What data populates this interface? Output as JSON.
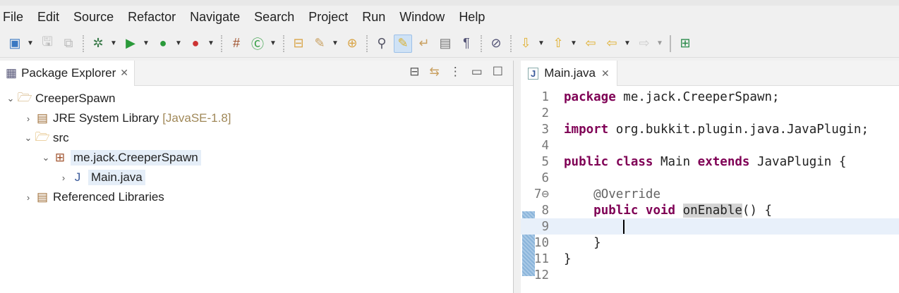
{
  "menu": [
    "File",
    "Edit",
    "Source",
    "Refactor",
    "Navigate",
    "Search",
    "Project",
    "Run",
    "Window",
    "Help"
  ],
  "explorer": {
    "title": "Package Explorer",
    "tree": [
      {
        "label": "CreeperSpawn",
        "icon": "project-icon",
        "depth": 0,
        "expanded": true
      },
      {
        "label": "JRE System Library",
        "suffix": "[JavaSE-1.8]",
        "icon": "library-icon",
        "depth": 1,
        "expanded": false
      },
      {
        "label": "src",
        "icon": "source-folder-icon",
        "depth": 1,
        "expanded": true
      },
      {
        "label": "me.jack.CreeperSpawn",
        "icon": "package-icon",
        "depth": 2,
        "expanded": true
      },
      {
        "label": "Main.java",
        "icon": "java-file-icon",
        "depth": 3,
        "expanded": false,
        "selected": true
      },
      {
        "label": "Referenced Libraries",
        "icon": "library-icon",
        "depth": 1,
        "expanded": false
      }
    ]
  },
  "editor": {
    "tab": "Main.java",
    "lines": [
      {
        "n": "1",
        "code": "package me.jack.CreeperSpawn;"
      },
      {
        "n": "2",
        "code": ""
      },
      {
        "n": "3",
        "code": "import org.bukkit.plugin.java.JavaPlugin;"
      },
      {
        "n": "4",
        "code": ""
      },
      {
        "n": "5",
        "code": "public class Main extends JavaPlugin {"
      },
      {
        "n": "6",
        "code": ""
      },
      {
        "n": "7⊖",
        "code": "    @Override"
      },
      {
        "n": "8",
        "code": "    public void onEnable() {"
      },
      {
        "n": "9",
        "code": ""
      },
      {
        "n": "10",
        "code": "    }"
      },
      {
        "n": "11",
        "code": "}"
      },
      {
        "n": "12",
        "code": ""
      }
    ]
  }
}
